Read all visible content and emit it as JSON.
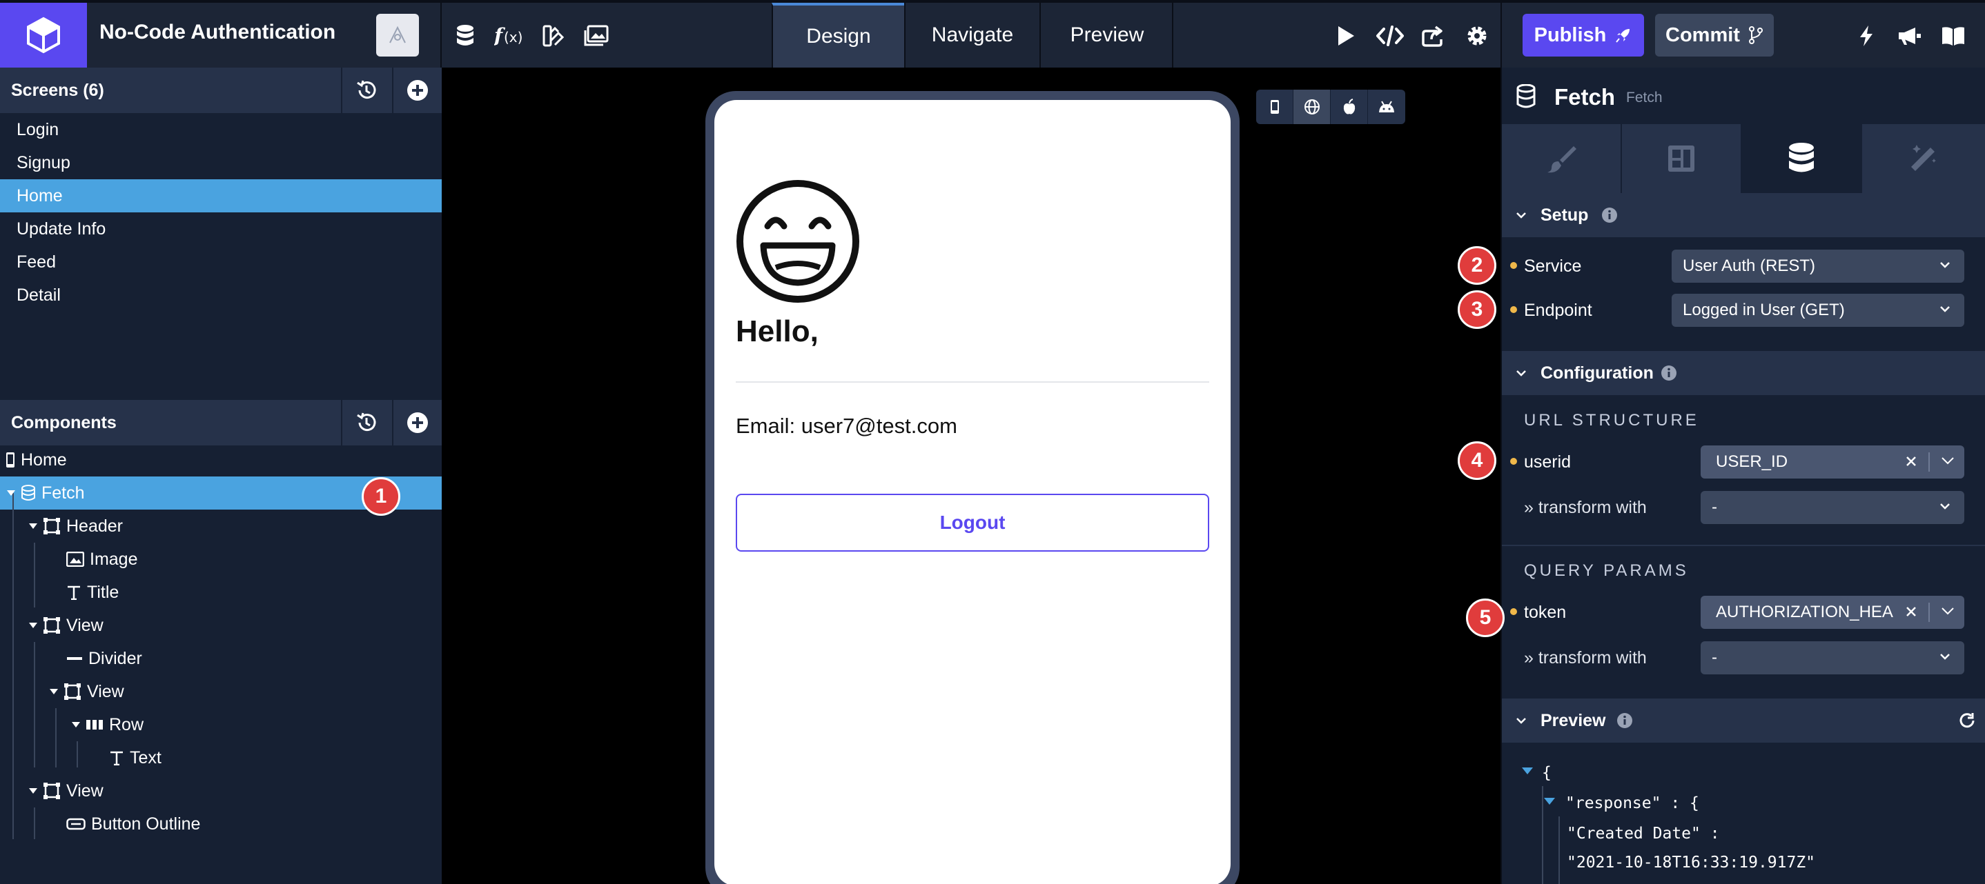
{
  "header": {
    "project_title": "No-Code Authentication",
    "tabs": [
      "Design",
      "Navigate",
      "Preview"
    ],
    "active_tab": "Design",
    "publish_label": "Publish",
    "commit_label": "Commit"
  },
  "screens": {
    "title": "Screens (6)",
    "items": [
      "Login",
      "Signup",
      "Home",
      "Update Info",
      "Feed",
      "Detail"
    ],
    "selected": "Home"
  },
  "components": {
    "title": "Components",
    "items": [
      "Home",
      "Fetch",
      "Header",
      "Image",
      "Title",
      "View",
      "Divider",
      "View",
      "Row",
      "Text",
      "View",
      "Button Outline"
    ],
    "selected": "Fetch"
  },
  "canvas": {
    "greeting": "Hello,",
    "email": "Email: user7@test.com",
    "logout_label": "Logout"
  },
  "inspector": {
    "title": "Fetch",
    "subtitle": "Fetch",
    "setup": {
      "title": "Setup",
      "service_label": "Service",
      "service_value": "User Auth (REST)",
      "endpoint_label": "Endpoint",
      "endpoint_value": "Logged in User (GET)"
    },
    "configuration": {
      "title": "Configuration",
      "url_structure": "URL STRUCTURE",
      "userid_label": "userid",
      "userid_value": "USER_ID",
      "transform_label": "» transform with",
      "transform_value": "-",
      "query_params": "QUERY PARAMS",
      "token_label": "token",
      "token_value": "AUTHORIZATION_HEA",
      "transform2_label": "» transform with",
      "transform2_value": "-"
    },
    "preview": {
      "title": "Preview",
      "json_open": "{",
      "response_key": "\"response\" : {",
      "created_key": "\"Created Date\" :",
      "created_value": "\"2021-10-18T16:33:19.917Z\""
    }
  },
  "badges": [
    "1",
    "2",
    "3",
    "4",
    "5"
  ],
  "colors": {
    "accent": "#5a48f0",
    "selection": "#4aa3e0",
    "badge": "#e03c3c",
    "panel": "#162033"
  }
}
